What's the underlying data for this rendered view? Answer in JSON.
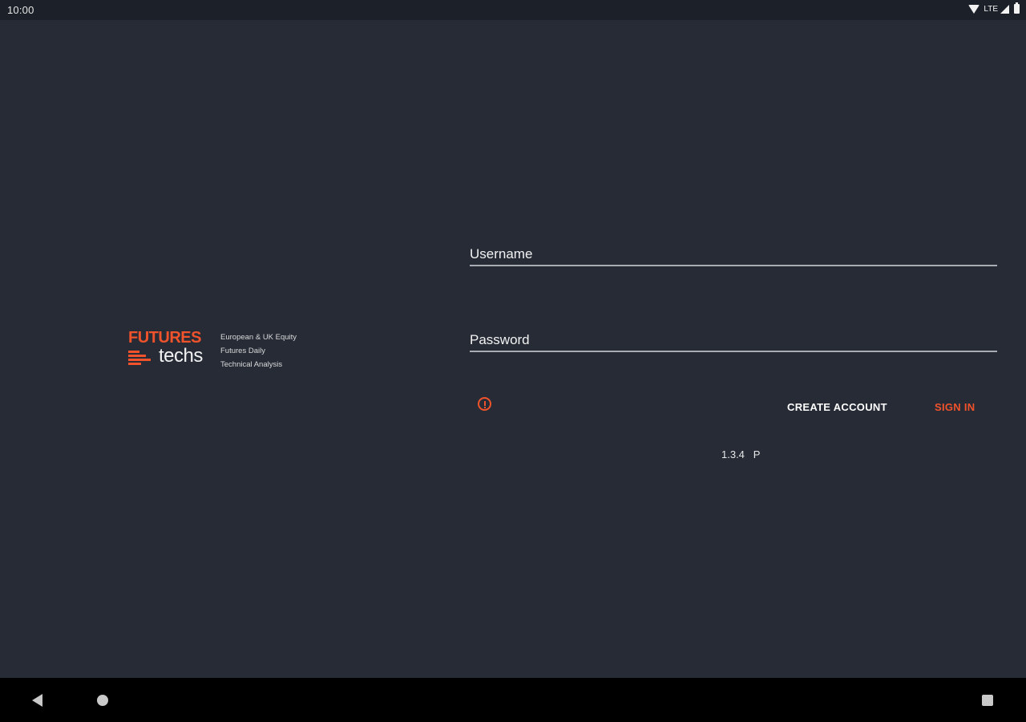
{
  "status_bar": {
    "time": "10:00",
    "network_label": "LTE",
    "icons": [
      "wifi-icon",
      "cell-signal-icon",
      "battery-icon"
    ]
  },
  "logo": {
    "brand_top": "FUTURES",
    "brand_bottom": "techs",
    "tagline_lines": [
      "European & UK Equity",
      "Futures Daily",
      "Technical Analysis"
    ]
  },
  "form": {
    "username_placeholder": "Username",
    "username_value": "",
    "password_placeholder": "Password",
    "password_value": "",
    "create_account_label": "CREATE ACCOUNT",
    "sign_in_label": "SIGN IN",
    "info_icon": "info-icon"
  },
  "version": {
    "number": "1.3.4",
    "flag": "P"
  },
  "nav_bar": {
    "icons": [
      "back-icon",
      "home-icon",
      "recents-icon"
    ]
  },
  "colors": {
    "background": "#262b36",
    "accent": "#f0532b",
    "text": "#f2f2f2"
  }
}
